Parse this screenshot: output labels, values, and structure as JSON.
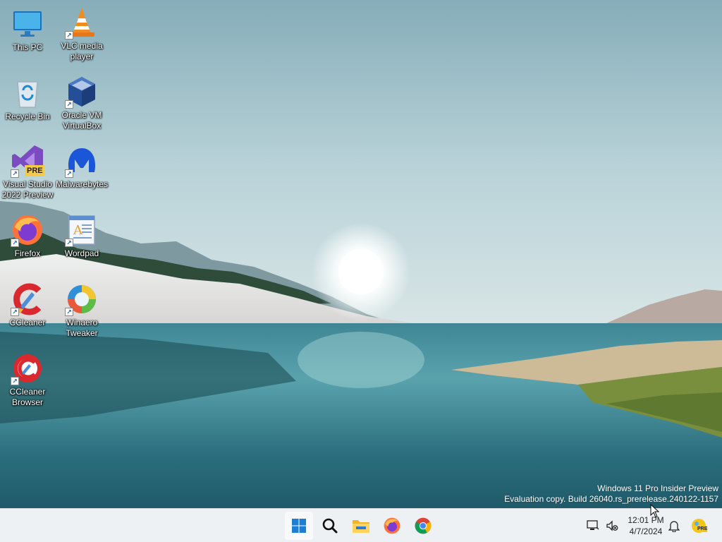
{
  "desktop": {
    "icons": [
      {
        "label": "This PC",
        "icon": "monitor-icon",
        "shortcut": false
      },
      {
        "label": "VLC media player",
        "icon": "vlc-cone-icon",
        "shortcut": true
      },
      {
        "label": "Recycle Bin",
        "icon": "recycle-bin-icon",
        "shortcut": false
      },
      {
        "label": "Oracle VM VirtualBox",
        "icon": "virtualbox-icon",
        "shortcut": true
      },
      {
        "label": "Visual Studio 2022 Preview",
        "icon": "visual-studio-preview-icon",
        "shortcut": true,
        "badge": "PRE"
      },
      {
        "label": "Malwarebytes",
        "icon": "malwarebytes-icon",
        "shortcut": true
      },
      {
        "label": "Firefox",
        "icon": "firefox-icon",
        "shortcut": true
      },
      {
        "label": "Wordpad",
        "icon": "wordpad-icon",
        "shortcut": true
      },
      {
        "label": "CCleaner",
        "icon": "ccleaner-icon",
        "shortcut": true
      },
      {
        "label": "Winaero Tweaker",
        "icon": "winaero-tweaker-icon",
        "shortcut": true
      },
      {
        "label": "CCleaner Browser",
        "icon": "ccleaner-browser-icon",
        "shortcut": true
      }
    ]
  },
  "watermark": {
    "line1": "Windows 11 Pro Insider Preview",
    "line2": "Evaluation copy. Build 26040.rs_prerelease.240122-1157"
  },
  "taskbar": {
    "pinned": [
      {
        "name": "start",
        "icon": "windows-start-icon"
      },
      {
        "name": "search",
        "icon": "search-icon"
      },
      {
        "name": "file-explorer",
        "icon": "folder-icon"
      },
      {
        "name": "firefox",
        "icon": "firefox-icon"
      },
      {
        "name": "chrome",
        "icon": "chrome-icon"
      }
    ],
    "tray": {
      "network_icon": "network-icon",
      "volume_icon": "volume-muted-icon",
      "time": "12:01 PM",
      "date": "4/7/2024",
      "notification_icon": "bell-icon",
      "insider_badge": "PRE"
    }
  },
  "colors": {
    "taskbar_bg": "#eef1f4",
    "sky_top": "#86adb9",
    "water_dark": "#1f5a6a"
  }
}
